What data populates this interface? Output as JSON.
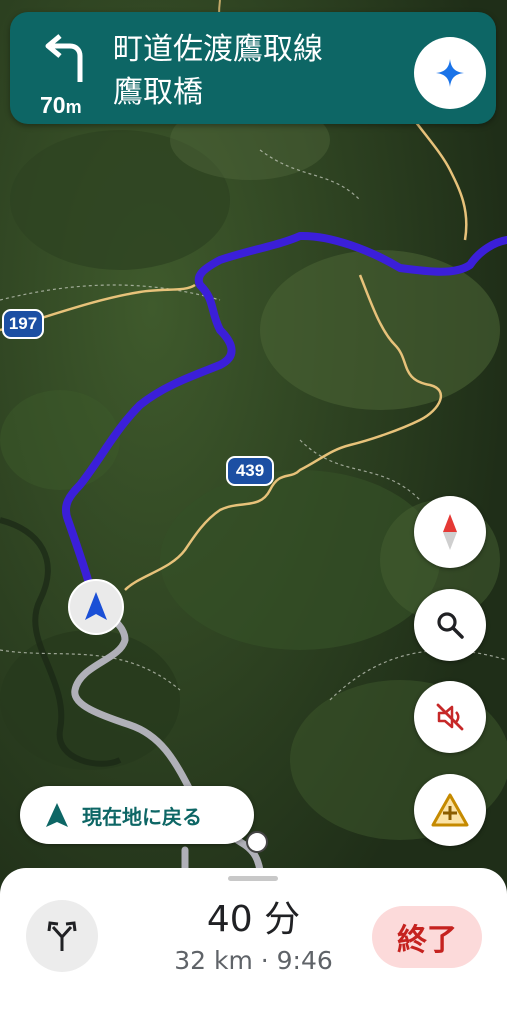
{
  "navigation": {
    "turn_distance_value": "70",
    "turn_distance_unit": "m",
    "street_line1": "町道佐渡鷹取線",
    "street_line2": "鷹取橋",
    "turn_icon": "turn-left-icon",
    "assistant_icon": "sparkle-icon"
  },
  "map": {
    "road_shields": [
      "197",
      "439"
    ],
    "route_color": "#3b1fd9",
    "alt_route_color": "#b0b0b8",
    "minor_road_color": "#e7c27a"
  },
  "controls": {
    "compass_icon": "compass-icon",
    "search_icon": "search-icon",
    "mute_icon": "sound-off-icon",
    "report_icon": "report-incident-icon"
  },
  "recenter": {
    "label": "現在地に戻る",
    "icon": "navigation-arrow-icon"
  },
  "bottom_sheet": {
    "eta_time": "40 分",
    "trip_info": "32 km · 9:46",
    "end_label": "終了",
    "routes_icon": "alternate-routes-icon"
  }
}
